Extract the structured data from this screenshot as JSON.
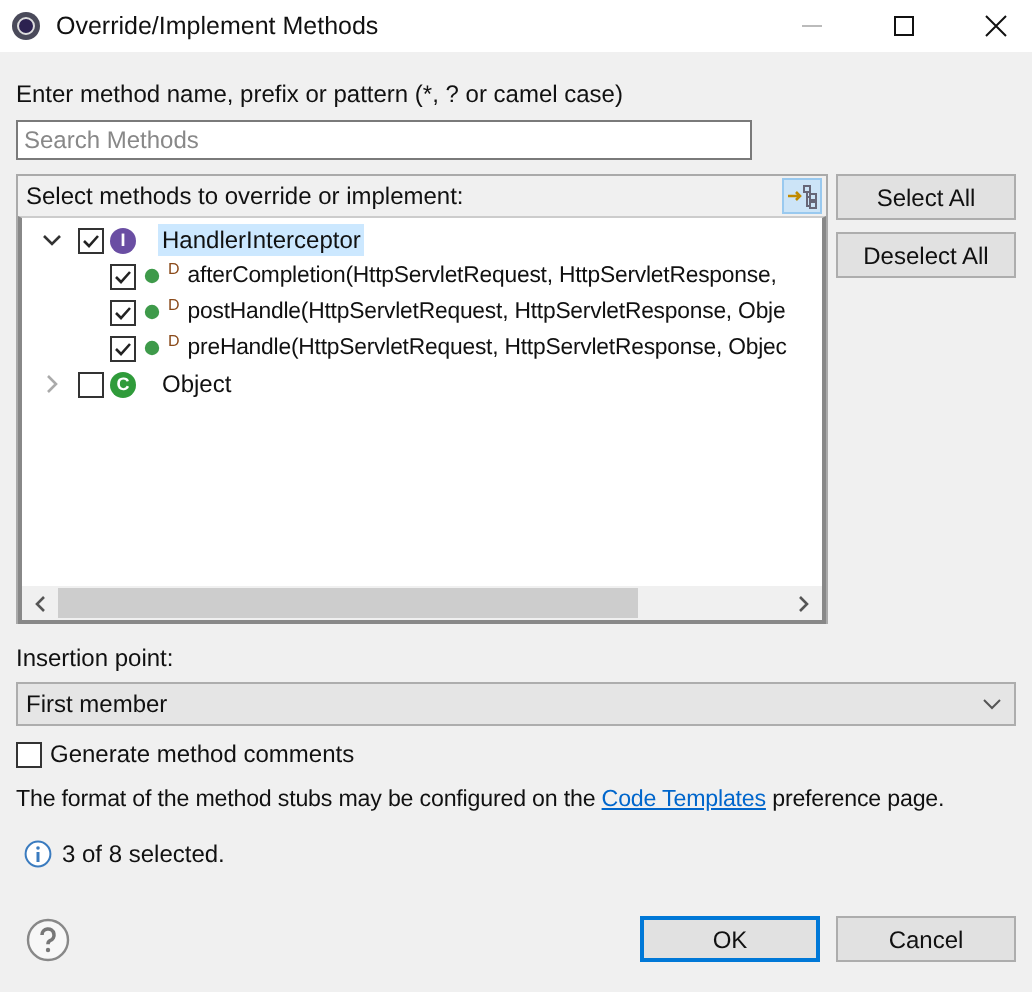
{
  "window": {
    "title": "Override/Implement Methods"
  },
  "filter": {
    "label": "Enter method name, prefix or pattern (*, ? or camel case)",
    "placeholder": "Search Methods"
  },
  "tree": {
    "label": "Select methods to override or implement:",
    "items": [
      {
        "kind": "interface",
        "badge": "I",
        "label": "HandlerInterceptor",
        "checked": true,
        "expanded": true,
        "selected": true,
        "children": [
          {
            "modifier": "D",
            "label": "afterCompletion(HttpServletRequest, HttpServletResponse,",
            "checked": true,
            "selected": false
          },
          {
            "modifier": "D",
            "label": "postHandle(HttpServletRequest, HttpServletResponse, Obje",
            "checked": true,
            "selected": false
          },
          {
            "modifier": "D",
            "label": "preHandle(HttpServletRequest, HttpServletResponse, Objec",
            "checked": true,
            "selected": false
          }
        ]
      },
      {
        "kind": "class",
        "badge": "C",
        "label": "Object",
        "checked": false,
        "expanded": false,
        "selected": false
      }
    ]
  },
  "side_buttons": [
    "Select All",
    "Deselect All"
  ],
  "insertion": {
    "label": "Insertion point:",
    "value": "First member"
  },
  "generate_comments": {
    "label": "Generate method comments",
    "checked": false
  },
  "note": {
    "before": "The format of the method stubs may be configured on the",
    "link": "Code Templates",
    "after": "preference page."
  },
  "status": "3 of 8 selected.",
  "buttons": [
    {
      "label": "OK",
      "default": true
    },
    {
      "label": "Cancel",
      "default": false
    }
  ]
}
